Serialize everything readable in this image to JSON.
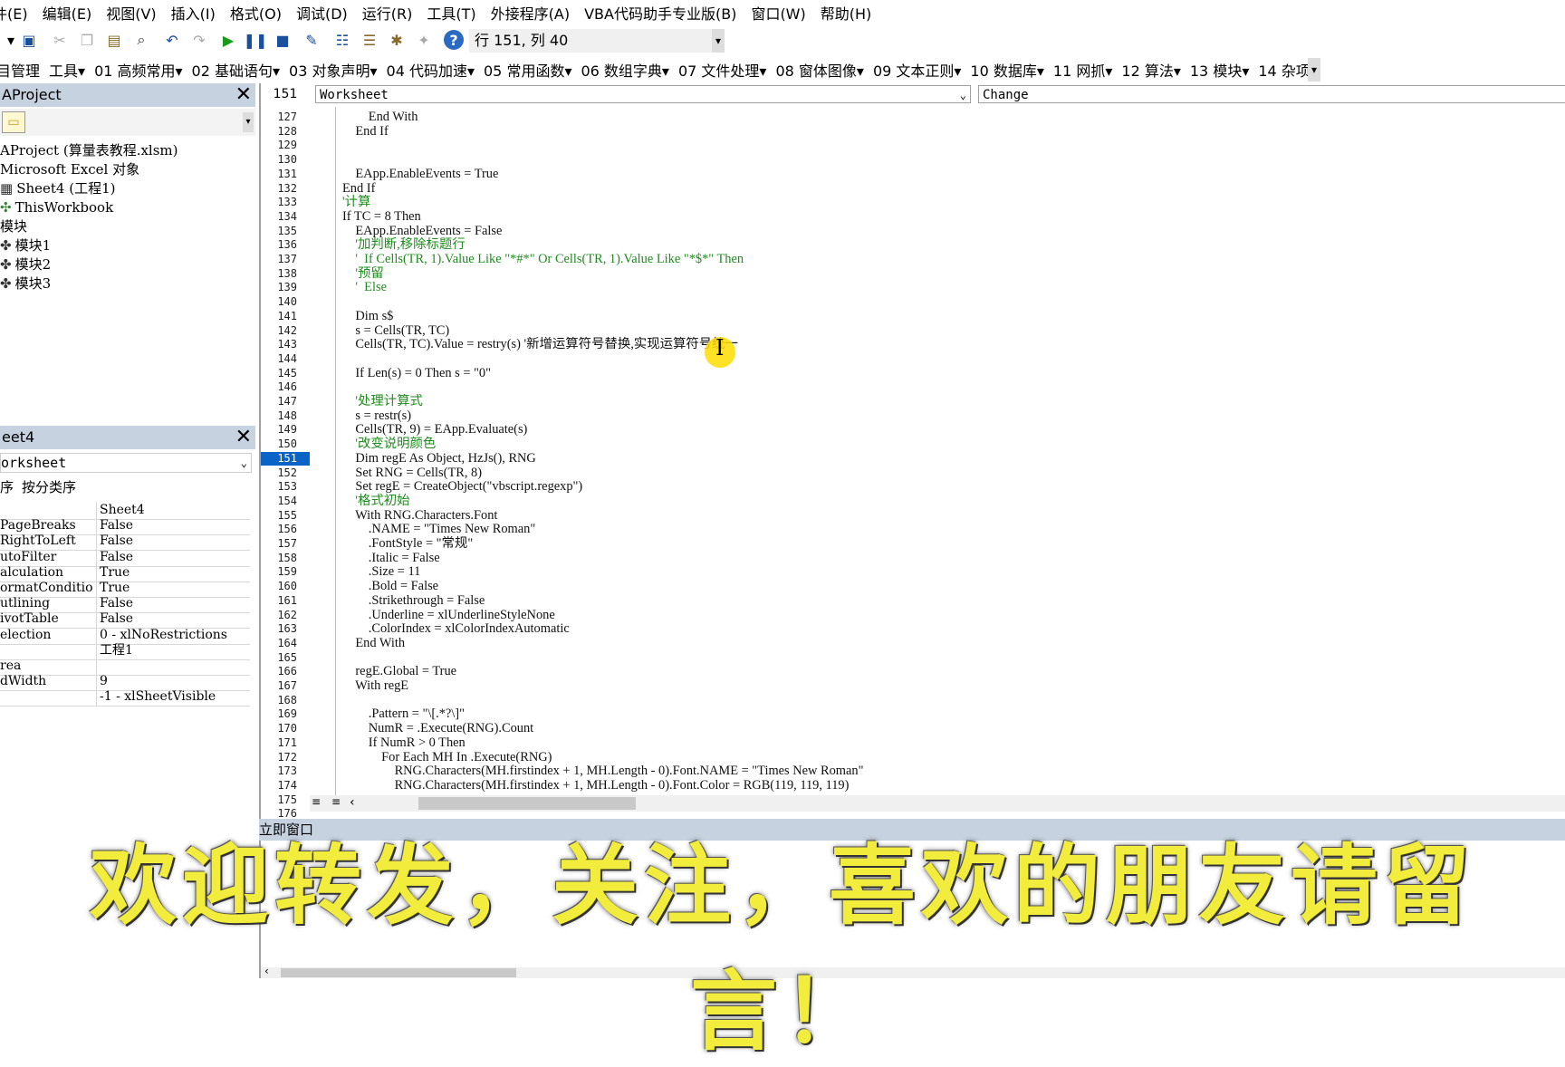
{
  "menu": [
    "件(E)",
    "编辑(E)",
    "视图(V)",
    "插入(I)",
    "格式(O)",
    "调试(D)",
    "运行(R)",
    "工具(T)",
    "外接程序(A)",
    "VBA代码助手专业版(B)",
    "窗口(W)",
    "帮助(H)"
  ],
  "toolbar": {
    "position": "行 151, 列 40"
  },
  "toolbar2": [
    "目管理",
    "工具▾",
    "01 高频常用▾",
    "02 基础语句▾",
    "03 对象声明▾",
    "04 代码加速▾",
    "05 常用函数▾",
    "06 数组字典▾",
    "07 文件处理▾",
    "08 窗体图像▾",
    "09 文本正则▾",
    "10 数据库▾",
    "11 网抓▾",
    "12 算法▾",
    "13 模块▾",
    "14 杂项▾"
  ],
  "project": {
    "title": "AProject",
    "tree": [
      "AProject (算量表教程.xlsm)",
      "Microsoft Excel 对象",
      "Sheet4 (工程1)",
      "ThisWorkbook",
      "模块",
      "模块1",
      "模块2",
      "模块3"
    ]
  },
  "props": {
    "title": "eet4",
    "object": "orksheet",
    "tabs": [
      "序",
      "按分类序"
    ],
    "rows": [
      {
        "n": "",
        "v": "Sheet4"
      },
      {
        "n": "PageBreaks",
        "v": "False"
      },
      {
        "n": "RightToLeft",
        "v": "False"
      },
      {
        "n": "utoFilter",
        "v": "False"
      },
      {
        "n": "alculation",
        "v": "True"
      },
      {
        "n": "ormatConditio",
        "v": "True"
      },
      {
        "n": "utlining",
        "v": "False"
      },
      {
        "n": "ivotTable",
        "v": "False"
      },
      {
        "n": "election",
        "v": "0 - xlNoRestrictions"
      },
      {
        "n": "",
        "v": "工程1"
      },
      {
        "n": "rea",
        "v": ""
      },
      {
        "n": "dWidth",
        "v": "9"
      },
      {
        "n": "",
        "v": "-1 - xlSheetVisible"
      }
    ]
  },
  "code": {
    "header_line": "151",
    "object": "Worksheet",
    "procedure": "Change",
    "lines": [
      {
        "n": "127",
        "t": "        End With"
      },
      {
        "n": "128",
        "t": "    End If"
      },
      {
        "n": "129",
        "t": ""
      },
      {
        "n": "130",
        "t": ""
      },
      {
        "n": "131",
        "t": "    EApp.EnableEvents = True"
      },
      {
        "n": "132",
        "t": "End If"
      },
      {
        "n": "133",
        "t": "'计算",
        "c": true
      },
      {
        "n": "134",
        "t": "If TC = 8 Then"
      },
      {
        "n": "135",
        "t": "    EApp.EnableEvents = False"
      },
      {
        "n": "136",
        "t": "    '加判断,移除标题行",
        "c": true
      },
      {
        "n": "137",
        "t": "    '  If Cells(TR, 1).Value Like \"*#*\" Or Cells(TR, 1).Value Like \"*$*\" Then",
        "c": true
      },
      {
        "n": "138",
        "t": "    '预留",
        "c": true
      },
      {
        "n": "139",
        "t": "    '  Else",
        "c": true
      },
      {
        "n": "140",
        "t": ""
      },
      {
        "n": "141",
        "t": "    Dim s$"
      },
      {
        "n": "142",
        "t": "    s = Cells(TR, TC)"
      },
      {
        "n": "143",
        "t": "    Cells(TR, TC).Value = restry(s) '新增运算符号替换,实现运算符号统一"
      },
      {
        "n": "144",
        "t": ""
      },
      {
        "n": "145",
        "t": "    If Len(s) = 0 Then s = \"0\""
      },
      {
        "n": "146",
        "t": ""
      },
      {
        "n": "147",
        "t": "    '处理计算式",
        "c": true
      },
      {
        "n": "148",
        "t": "    s = restr(s)"
      },
      {
        "n": "149",
        "t": "    Cells(TR, 9) = EApp.Evaluate(s)"
      },
      {
        "n": "150",
        "t": "    '改变说明颜色",
        "c": true
      },
      {
        "n": "151",
        "t": "    Dim regE As Object, HzJs(), RNG"
      },
      {
        "n": "152",
        "t": "    Set RNG = Cells(TR, 8)"
      },
      {
        "n": "153",
        "t": "    Set regE = CreateObject(\"vbscript.regexp\")"
      },
      {
        "n": "154",
        "t": "    '格式初始",
        "c": true
      },
      {
        "n": "155",
        "t": "    With RNG.Characters.Font"
      },
      {
        "n": "156",
        "t": "        .NAME = \"Times New Roman\""
      },
      {
        "n": "157",
        "t": "        .FontStyle = \"常规\""
      },
      {
        "n": "158",
        "t": "        .Italic = False"
      },
      {
        "n": "159",
        "t": "        .Size = 11"
      },
      {
        "n": "160",
        "t": "        .Bold = False"
      },
      {
        "n": "161",
        "t": "        .Strikethrough = False"
      },
      {
        "n": "162",
        "t": "        .Underline = xlUnderlineStyleNone"
      },
      {
        "n": "163",
        "t": "        .ColorIndex = xlColorIndexAutomatic"
      },
      {
        "n": "164",
        "t": "    End With"
      },
      {
        "n": "165",
        "t": ""
      },
      {
        "n": "166",
        "t": "    regE.Global = True"
      },
      {
        "n": "167",
        "t": "    With regE"
      },
      {
        "n": "168",
        "t": ""
      },
      {
        "n": "169",
        "t": "        .Pattern = \"\\[.*?\\]\""
      },
      {
        "n": "170",
        "t": "        NumR = .Execute(RNG).Count"
      },
      {
        "n": "171",
        "t": "        If NumR > 0 Then"
      },
      {
        "n": "172",
        "t": "            For Each MH In .Execute(RNG)"
      },
      {
        "n": "173",
        "t": "                RNG.Characters(MH.firstindex + 1, MH.Length - 0).Font.NAME = \"Times New Roman\""
      },
      {
        "n": "174",
        "t": "                RNG.Characters(MH.firstindex + 1, MH.Length - 0).Font.Color = RGB(119, 119, 119)"
      },
      {
        "n": "175",
        "t": ""
      },
      {
        "n": "176",
        "t": ""
      }
    ]
  },
  "immediate": {
    "title": "立即窗口"
  },
  "banner": "欢迎转发，关注，喜欢的朋友请留言！"
}
